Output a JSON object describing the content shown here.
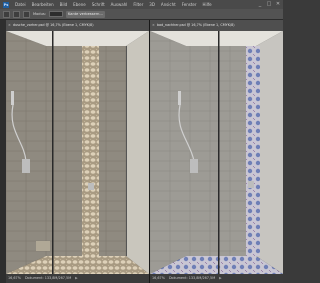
{
  "menubar": {
    "logo": "Ps",
    "items": [
      "Datei",
      "Bearbeiten",
      "Bild",
      "Ebene",
      "Schrift",
      "Auswahl",
      "Filter",
      "3D",
      "Ansicht",
      "Fenster",
      "Hilfe"
    ],
    "window_controls": [
      "_",
      "□",
      "✕"
    ]
  },
  "optionsbar": {
    "mode_label": "Modus:",
    "mode_value": "Normal",
    "action_label": "Kante verbessern..."
  },
  "documents": [
    {
      "tab_title": "dusche_vorher.psd @ 16,7% (Ebene 1, CMYK/8)",
      "zoom": "16,67%",
      "doc_info": "Dokument: 133,8M/267,5M"
    },
    {
      "tab_title": "bad_nachher.psd @ 16,7% (Ebene 1, CMYK/8)",
      "zoom": "16,67%",
      "doc_info": "Dokument: 133,8M/267,5M"
    }
  ],
  "colors": {
    "left_wall_tile": "#8f8a80",
    "right_wall_tile": "#9d9b95",
    "pebble": "#d9cbb3",
    "pattern_blue": "#6f7fb6"
  }
}
